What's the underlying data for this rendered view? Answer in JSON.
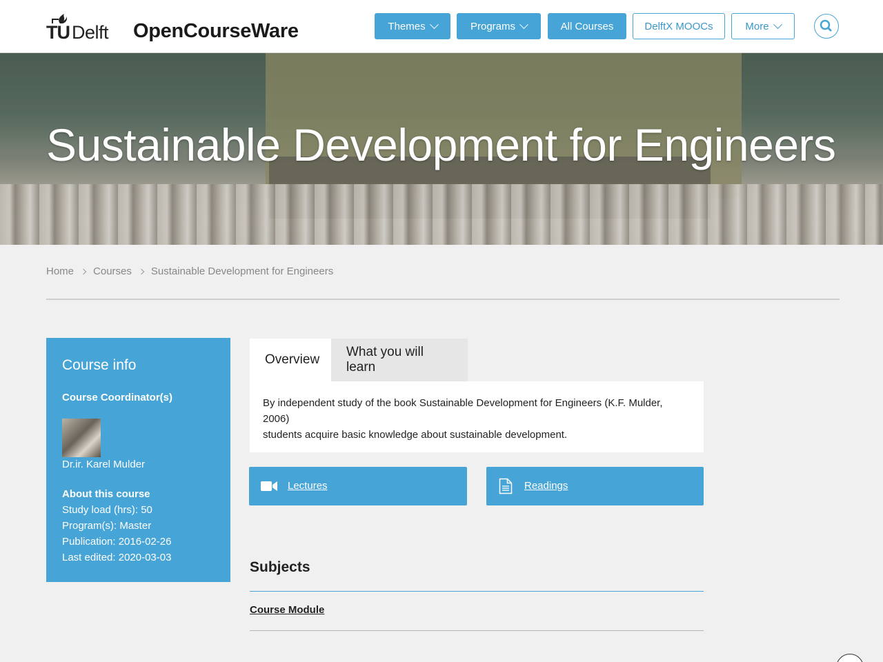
{
  "brand": {
    "logo_tu": "TU",
    "logo_delft": "Delft",
    "site_title": "OpenCourseWare"
  },
  "nav": {
    "items": [
      {
        "label": "Themes"
      },
      {
        "label": "Programs"
      },
      {
        "label": "All Courses"
      },
      {
        "label": "DelftX MOOCs"
      },
      {
        "label": "More"
      }
    ]
  },
  "hero": {
    "title": "Sustainable Development for Engineers"
  },
  "breadcrumb": {
    "items": [
      "Home",
      "Courses",
      "Sustainable Development for Engineers"
    ]
  },
  "course_info": {
    "title": "Course info",
    "coordinator_label": "Course Coordinator(s)",
    "coordinator_name": "Dr.ir. Karel Mulder",
    "about_label": "About this course",
    "details": [
      "Study load (hrs): 50",
      "Program(s): Master",
      "Publication: 2016-02-26",
      "Last edited: 2020-03-03"
    ]
  },
  "tabs": {
    "items": [
      "Overview",
      "What you will learn"
    ],
    "active": "Overview",
    "overview_text_line1": "By independent study of the book Sustainable Development for Engineers (K.F. Mulder, 2006)",
    "overview_text_line2": "students acquire basic knowledge about sustainable development."
  },
  "resources": {
    "lectures": "Lectures",
    "readings": "Readings"
  },
  "subjects": {
    "title": "Subjects",
    "items": [
      "Course Module"
    ]
  },
  "colors": {
    "accent": "#47a4d6",
    "background": "#f0f0f0"
  }
}
